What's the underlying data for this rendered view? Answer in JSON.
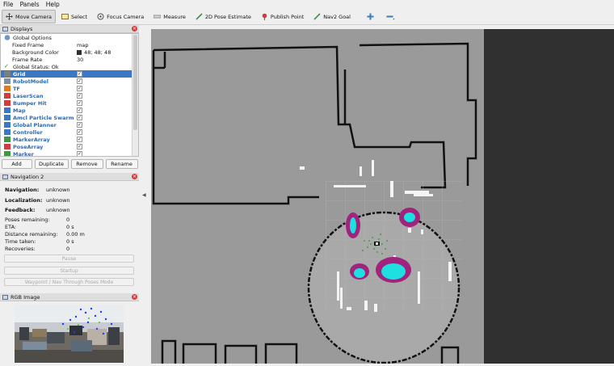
{
  "menubar": [
    "File",
    "Panels",
    "Help"
  ],
  "toolbar": {
    "tools": [
      {
        "label": "Move Camera",
        "icon": "move-camera-icon",
        "active": true
      },
      {
        "label": "Select",
        "icon": "select-icon"
      },
      {
        "label": "Focus Camera",
        "icon": "focus-camera-icon"
      },
      {
        "label": "Measure",
        "icon": "measure-icon"
      },
      {
        "label": "2D Pose Estimate",
        "icon": "pose-estimate-icon"
      },
      {
        "label": "Publish Point",
        "icon": "publish-point-icon"
      },
      {
        "label": "Nav2 Goal",
        "icon": "nav2-goal-icon"
      }
    ],
    "extra_icons": [
      "add-tool-icon",
      "remove-tool-icon"
    ]
  },
  "displays": {
    "title": "Displays",
    "global_options": {
      "label": "Global Options",
      "fixed_frame_label": "Fixed Frame",
      "fixed_frame": "map",
      "background_label": "Background Color",
      "background": "48; 48; 48",
      "background_hex": "#303030",
      "frame_rate_label": "Frame Rate",
      "frame_rate": "30"
    },
    "global_status": "Global Status: Ok",
    "items": [
      {
        "label": "Grid",
        "color": "#7f7f7f",
        "checked": true,
        "selected": true
      },
      {
        "label": "RobotModel",
        "color": "#7d8fa6",
        "checked": true
      },
      {
        "label": "TF",
        "color": "#e07a1f",
        "checked": true
      },
      {
        "label": "LaserScan",
        "color": "#d23c3c",
        "checked": true
      },
      {
        "label": "Bumper Hit",
        "color": "#d23c3c",
        "checked": true
      },
      {
        "label": "Map",
        "color": "#3b78c4",
        "checked": true
      },
      {
        "label": "Amcl Particle Swarm",
        "color": "#3b78c4",
        "checked": true
      },
      {
        "label": "Global Planner",
        "color": "#3b78c4",
        "checked": true
      },
      {
        "label": "Controller",
        "color": "#3b78c4",
        "checked": true
      },
      {
        "label": "MarkerArray",
        "color": "#3b9a3b",
        "checked": true
      },
      {
        "label": "PoseArray",
        "color": "#d23c3c",
        "checked": true
      },
      {
        "label": "Marker",
        "color": "#3b9a3b",
        "checked": true
      }
    ],
    "buttons": [
      "Add",
      "Duplicate",
      "Remove",
      "Rename"
    ]
  },
  "navigation": {
    "title": "Navigation 2",
    "navigation_label": "Navigation:",
    "navigation_value": "unknown",
    "localization_label": "Localization:",
    "localization_value": "unknown",
    "feedback_label": "Feedback:",
    "feedback_value": "unknown",
    "poses_remaining_label": "Poses remaining:",
    "poses_remaining": "0",
    "eta_label": "ETA:",
    "eta": "0 s",
    "distance_label": "Distance remaining:",
    "distance": "0.00 m",
    "time_taken_label": "Time taken:",
    "time_taken": "0 s",
    "recoveries_label": "Recoveries:",
    "recoveries": "0",
    "buttons": [
      "Pause",
      "Startup",
      "Waypoint / Nav Through Poses Mode"
    ]
  },
  "rgb": {
    "title": "RGB Image"
  }
}
